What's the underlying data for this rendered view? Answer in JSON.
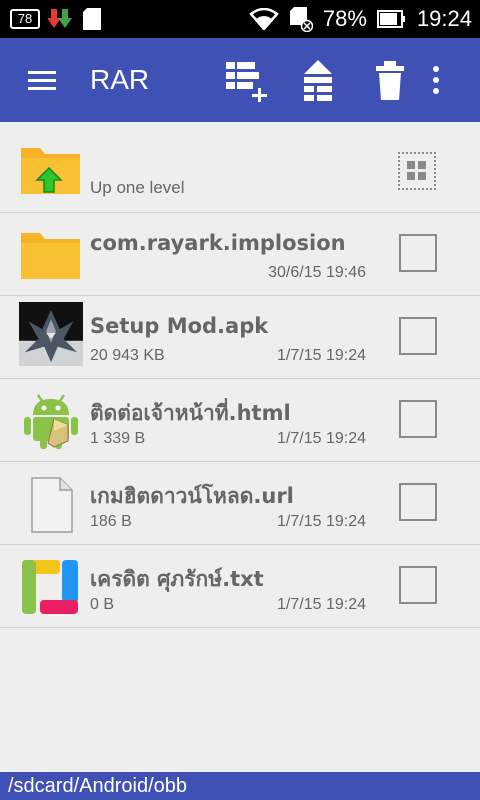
{
  "status_bar": {
    "notif_badge": "78",
    "battery": "78%",
    "time": "19:24"
  },
  "toolbar": {
    "title": "RAR",
    "color": "#3f51b5"
  },
  "up_level": {
    "label": "Up one level"
  },
  "files": [
    {
      "name": "com.rayark.implosion",
      "size": "",
      "date": "30/6/15 19:46",
      "icon": "folder-icon"
    },
    {
      "name": "Setup Mod.apk",
      "size": "20 943 KB",
      "date": "1/7/15 19:24",
      "icon": "apk-thumbnail-icon"
    },
    {
      "name": "ติดต่อเจ้าหน้าที่.html",
      "size": "1 339 B",
      "date": "1/7/15 19:24",
      "icon": "android-html-icon"
    },
    {
      "name": "เกมฮิตดาวน์โหลด.url",
      "size": "186 B",
      "date": "1/7/15 19:24",
      "icon": "document-icon"
    },
    {
      "name": "เครดิต ศุภรักษ์.txt",
      "size": "0 B",
      "date": "1/7/15 19:24",
      "icon": "text-file-icon"
    }
  ],
  "path": "/sdcard/Android/obb"
}
